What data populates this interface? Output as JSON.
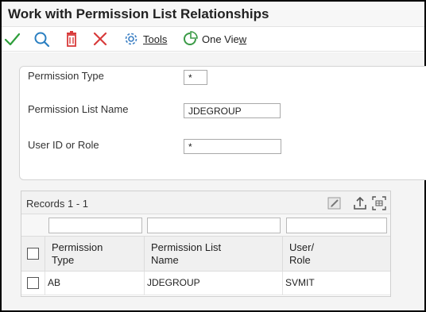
{
  "title": "Work with Permission List Relationships",
  "toolbar": {
    "select_icon": "checkmark-icon",
    "find_icon": "search-icon",
    "delete_icon": "trash-icon",
    "close_icon": "close-icon",
    "tools_icon": "gear-icon",
    "tools_label": "Tools",
    "oneview_icon": "pie-chart-icon",
    "oneview_label_main": "One Vie",
    "oneview_label_ul": "w"
  },
  "criteria": {
    "permission_type_label": "Permission Type",
    "permission_type_value": "*",
    "permission_list_label": "Permission List Name",
    "permission_list_value": "JDEGROUP",
    "user_role_label": "User ID or Role",
    "user_role_value": "*"
  },
  "grid": {
    "records_label": "Records 1 - 1",
    "columns": [
      {
        "line1": "Permission",
        "line2": "Type"
      },
      {
        "line1": "Permission List",
        "line2": "Name"
      },
      {
        "line1": "User/",
        "line2": "Role"
      }
    ],
    "rows": [
      {
        "type": "AB",
        "list_name": "JDEGROUP",
        "user_role": "SVMIT"
      }
    ]
  },
  "colors": {
    "check_green": "#2e9e3b",
    "find_blue": "#2a7fc1",
    "delete_red": "#d83b3b",
    "gear_blue": "#3b7fc4",
    "oneview_green": "#3a9a46"
  }
}
